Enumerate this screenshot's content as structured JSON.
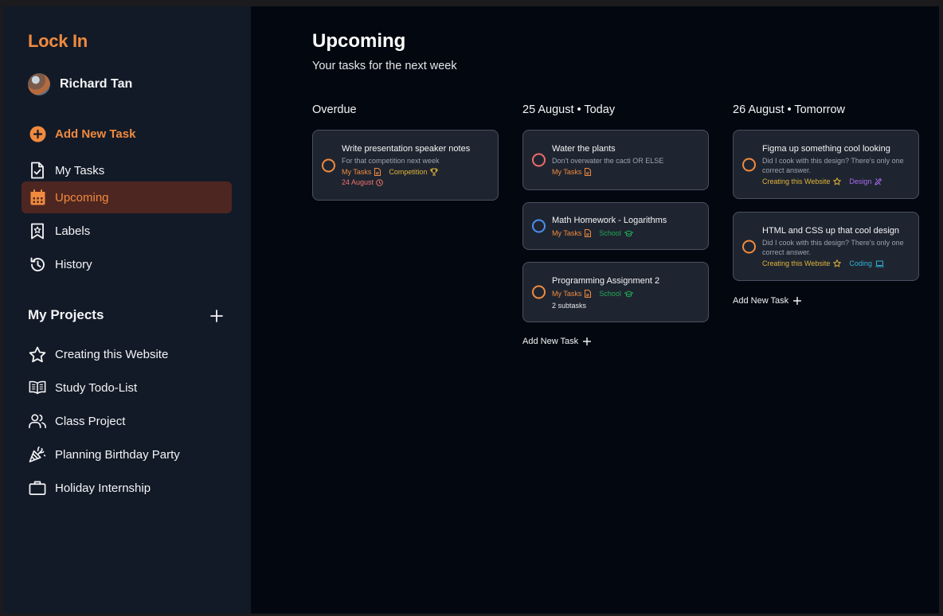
{
  "app": {
    "brand": "Lock In",
    "accent": "#f08a3e"
  },
  "user": {
    "name": "Richard Tan"
  },
  "nav": {
    "add_task": "Add New Task",
    "my_tasks": "My Tasks",
    "upcoming": "Upcoming",
    "labels": "Labels",
    "history": "History"
  },
  "projects": {
    "title": "My Projects",
    "items": [
      {
        "label": "Creating this Website",
        "icon": "star-icon"
      },
      {
        "label": "Study Todo-List",
        "icon": "book-icon"
      },
      {
        "label": "Class Project",
        "icon": "users-icon"
      },
      {
        "label": "Planning Birthday Party",
        "icon": "party-popper-icon"
      },
      {
        "label": "Holiday Internship",
        "icon": "briefcase-icon"
      }
    ]
  },
  "page": {
    "title": "Upcoming",
    "subtitle": "Your tasks for the next week"
  },
  "columns": [
    {
      "heading": "Overdue",
      "cards": [
        {
          "title": "Write presentation speaker notes",
          "desc": "For that competition next week",
          "tags": [
            {
              "label": "My Tasks",
              "color": "#f08a3e",
              "icon": "document-icon"
            },
            {
              "label": "Competition",
              "color": "#e0b43a",
              "icon": "trophy-icon"
            }
          ],
          "date": "24 August",
          "ring": "#f08a3e"
        }
      ]
    },
    {
      "heading": "25 August • Today",
      "add_label": "Add New Task",
      "cards": [
        {
          "title": "Water the plants",
          "desc": "Don't overwater the cacti OR ELSE",
          "tags": [
            {
              "label": "My Tasks",
              "color": "#f08a3e",
              "icon": "document-icon"
            }
          ],
          "ring": "#ef6b6b"
        },
        {
          "title": "Math Homework - Logarithms",
          "tags": [
            {
              "label": "My Tasks",
              "color": "#f08a3e",
              "icon": "document-icon"
            },
            {
              "label": "School",
              "color": "#22a85a",
              "icon": "graduation-cap-icon"
            }
          ],
          "ring": "#4b8ff0"
        },
        {
          "title": "Programming Assignment 2",
          "tags": [
            {
              "label": "My Tasks",
              "color": "#f08a3e",
              "icon": "document-icon"
            },
            {
              "label": "School",
              "color": "#22a85a",
              "icon": "graduation-cap-icon"
            }
          ],
          "subtasks": "2 subtasks",
          "ring": "#f08a3e"
        }
      ]
    },
    {
      "heading": "26 August • Tomorrow",
      "add_label": "Add New Task",
      "cards": [
        {
          "title": "Figma up something cool looking",
          "desc": "Did I cook with this design? There's only one correct answer.",
          "tags": [
            {
              "label": "Creating this Website",
              "color": "#e0b43a",
              "icon": "star-icon"
            },
            {
              "label": "Design",
              "color": "#a76bf0",
              "icon": "design-icon"
            }
          ],
          "ring": "#f08a3e"
        },
        {
          "title": "HTML and CSS up that cool design",
          "desc": "Did I cook with this design? There's only one correct answer.",
          "tags": [
            {
              "label": "Creating this Website",
              "color": "#e0b43a",
              "icon": "star-icon"
            },
            {
              "label": "Coding",
              "color": "#2fb4d8",
              "icon": "laptop-icon"
            }
          ],
          "ring": "#f08a3e"
        }
      ]
    }
  ]
}
